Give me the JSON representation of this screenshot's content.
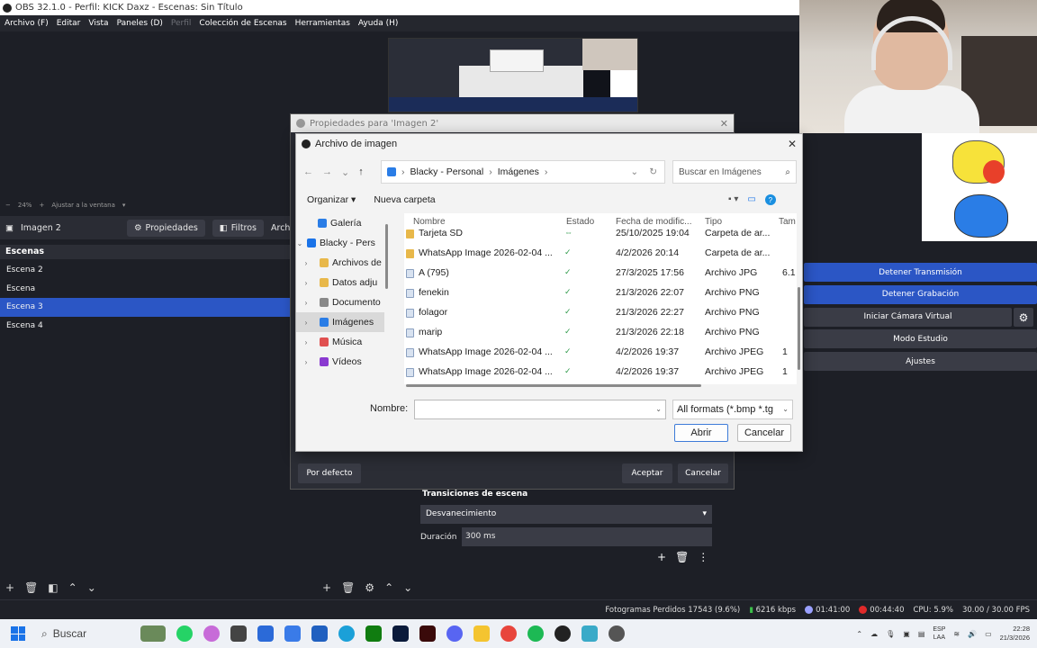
{
  "obs": {
    "title": "OBS 32.1.0 - Perfil: KICK Daxz - Escenas: Sin Título",
    "menu": [
      "Archivo (F)",
      "Editar",
      "Vista",
      "Paneles (D)",
      "Perfil",
      "Colección de Escenas",
      "Herramientas",
      "Ayuda (H)"
    ],
    "zoom": {
      "percent": "24%",
      "fit_label": "Ajustar a la ventana"
    },
    "source_bar": {
      "source_name": "Imagen 2",
      "properties": "Propiedades",
      "filters": "Filtros",
      "archive": "Archi"
    },
    "scenes": {
      "header": "Escenas",
      "items": [
        "Escena 2",
        "Escena",
        "Escena 3",
        "Escena 4"
      ],
      "selected": "Escena 3"
    },
    "controls": {
      "stop_stream": "Detener Transmisión",
      "stop_record": "Detener Grabación",
      "virtual_cam": "Iniciar Cámara Virtual",
      "studio_mode": "Modo Estudio",
      "settings": "Ajustes"
    },
    "transitions": {
      "header": "Transiciones de escena",
      "selected": "Desvanecimiento",
      "duration_label": "Duración",
      "duration_value": "300 ms"
    },
    "status": {
      "dropped": "Fotogramas Perdidos 17543 (9.6%)",
      "bitrate": "6216 kbps",
      "stream_time": "01:41:00",
      "rec_time": "00:44:40",
      "cpu": "CPU: 5.9%",
      "fps": "30.00 / 30.00 FPS"
    }
  },
  "properties_dialog": {
    "title": "Propiedades para 'Imagen 2'",
    "defaults": "Por defecto",
    "accept": "Aceptar",
    "cancel": "Cancelar"
  },
  "file_dialog": {
    "title": "Archivo de imagen",
    "breadcrumb": [
      "Blacky - Personal",
      "Imágenes"
    ],
    "search_placeholder": "Buscar en Imágenes",
    "organize": "Organizar",
    "new_folder": "Nueva carpeta",
    "nav": [
      {
        "label": "Galería",
        "color": "#2a7de6",
        "chev": ""
      },
      {
        "label": "Blacky - Pers",
        "color": "#1a73e8",
        "chev": "v"
      },
      {
        "label": "Archivos de",
        "color": "#e8b84a",
        "chev": ">"
      },
      {
        "label": "Datos adju",
        "color": "#e8b84a",
        "chev": ">"
      },
      {
        "label": "Documento",
        "color": "#888888",
        "chev": ">"
      },
      {
        "label": "Imágenes",
        "color": "#2a7de6",
        "chev": ">"
      },
      {
        "label": "Música",
        "color": "#e05050",
        "chev": ">"
      },
      {
        "label": "Vídeos",
        "color": "#8a3ad0",
        "chev": ">"
      }
    ],
    "columns": [
      "Nombre",
      "Estado",
      "Fecha de modific...",
      "Tipo",
      "Tam"
    ],
    "files": [
      {
        "name": "Tarjeta SD",
        "status": "⇔",
        "date": "25/10/2025 19:04",
        "type": "Carpeta de ar...",
        "size": "",
        "kind": "folder"
      },
      {
        "name": "WhatsApp Image 2026-02-04 ...",
        "status": "✓",
        "date": "4/2/2026 20:14",
        "type": "Carpeta de ar...",
        "size": "",
        "kind": "folder"
      },
      {
        "name": "A (795)",
        "status": "✓",
        "date": "27/3/2025 17:56",
        "type": "Archivo JPG",
        "size": "6.1",
        "kind": "file"
      },
      {
        "name": "fenekin",
        "status": "✓",
        "date": "21/3/2026 22:07",
        "type": "Archivo PNG",
        "size": "",
        "kind": "file"
      },
      {
        "name": "folagor",
        "status": "✓",
        "date": "21/3/2026 22:27",
        "type": "Archivo PNG",
        "size": "",
        "kind": "file"
      },
      {
        "name": "marip",
        "status": "✓",
        "date": "21/3/2026 22:18",
        "type": "Archivo PNG",
        "size": "",
        "kind": "file"
      },
      {
        "name": "WhatsApp Image 2026-02-04 ...",
        "status": "✓",
        "date": "4/2/2026 19:37",
        "type": "Archivo JPEG",
        "size": "1",
        "kind": "file"
      },
      {
        "name": "WhatsApp Image 2026-02-04 ...",
        "status": "✓",
        "date": "4/2/2026 19:37",
        "type": "Archivo JPEG",
        "size": "1",
        "kind": "file"
      }
    ],
    "name_label": "Nombre:",
    "name_value": "",
    "filter": "All formats (*.bmp *.tg",
    "open": "Abrir",
    "cancel": "Cancelar"
  },
  "taskbar": {
    "search": "Buscar",
    "lang_top": "ESP",
    "lang_bottom": "LAA",
    "time": "22:28",
    "date": "21/3/2026"
  }
}
